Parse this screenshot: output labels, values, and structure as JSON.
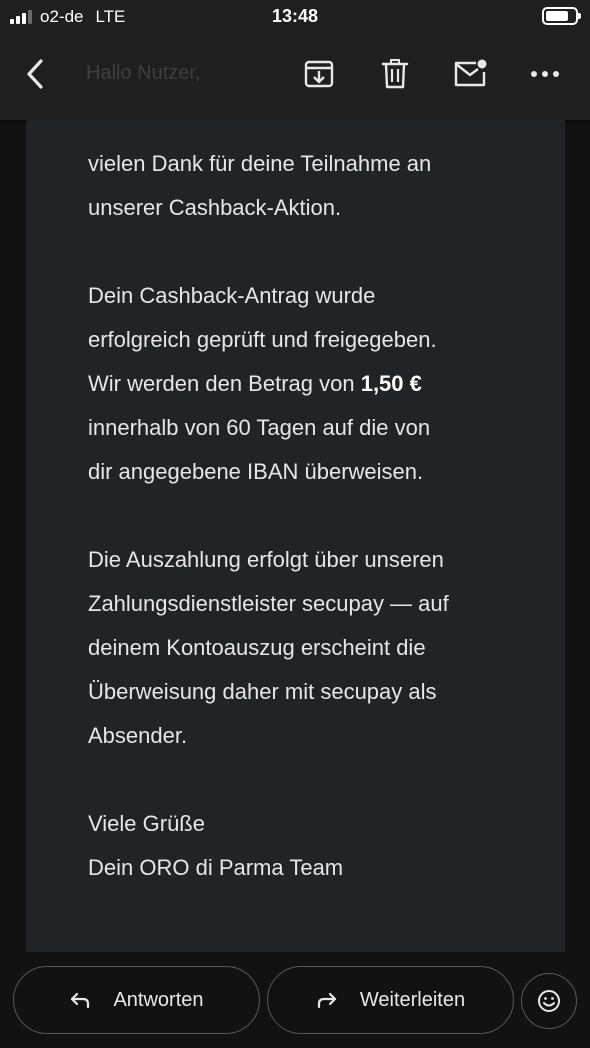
{
  "status_bar": {
    "carrier": "o2-de",
    "network": "LTE",
    "time": "13:48"
  },
  "toolbar": {
    "title": "Hallo Nutzer,",
    "icons": [
      "back-arrow-icon",
      "archive-icon",
      "trash-icon",
      "mark-unread-icon",
      "more-icon"
    ]
  },
  "email": {
    "lines_p1": [
      "vielen Dank für deine Teilnahme an",
      "unserer Cashback-Aktion."
    ],
    "p2_line1": "Dein Cashback-Antrag wurde",
    "p2_line2": "erfolgreich geprüft und freigegeben.",
    "p2_line3_pre": "Wir werden den Betrag von ",
    "p2_amount": "1,50  €",
    "p2_line4": "innerhalb von 60 Tagen auf die von",
    "p2_line5": "dir angegebene IBAN überweisen.",
    "p3_line1": "Die Auszahlung erfolgt über unseren",
    "p3_line2": "Zahlungsdienstleister secupay — auf",
    "p3_line3": "deinem Kontoauszug erscheint die",
    "p3_line4": "Überweisung daher mit secupay als",
    "p3_line5": "Absender.",
    "closing": "Viele Grüße",
    "signature": "Dein ORO di Parma Team"
  },
  "actions": {
    "reply_label": "Antworten",
    "forward_label": "Weiterleiten",
    "emoji_icon": "smiley-icon"
  },
  "colors": {
    "background": "#121212",
    "toolbar": "#1f1f1f",
    "card": "#222326",
    "text": "#e6e6e6"
  }
}
